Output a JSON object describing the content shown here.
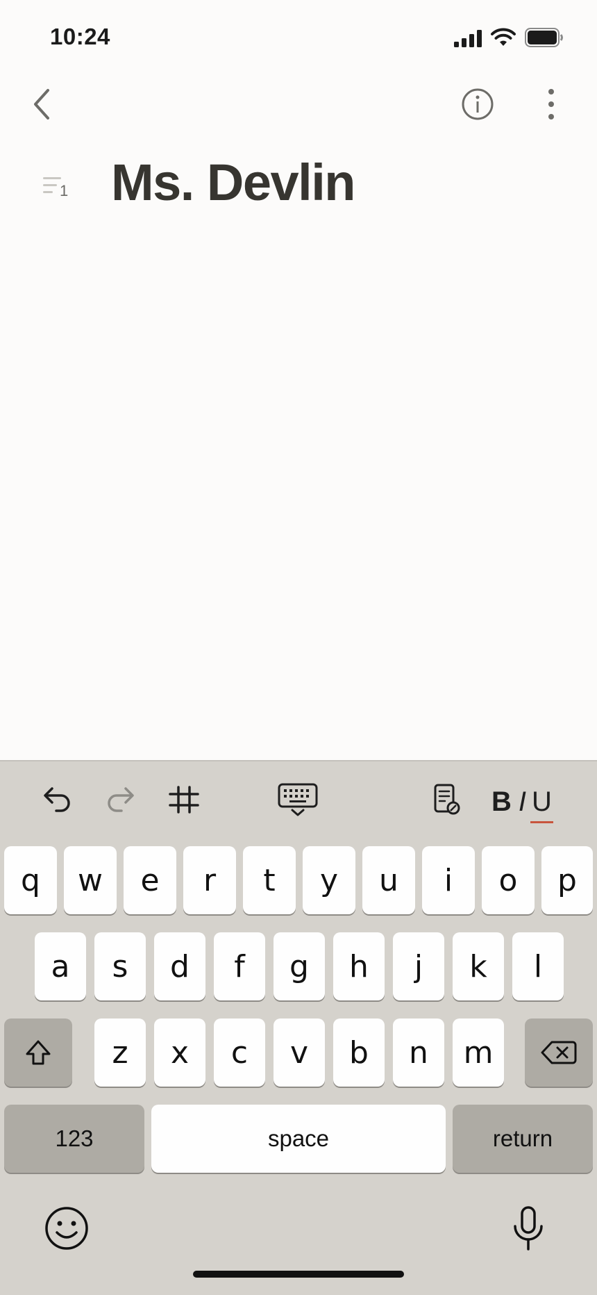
{
  "status_bar": {
    "time": "10:24"
  },
  "page": {
    "title": "Ms. Devlin",
    "toc_count": "1"
  },
  "toolbar": {
    "bold_label": "B",
    "italic_label": "I",
    "underline_label": "U"
  },
  "keyboard": {
    "row1": [
      "q",
      "w",
      "e",
      "r",
      "t",
      "y",
      "u",
      "i",
      "o",
      "p"
    ],
    "row2": [
      "a",
      "s",
      "d",
      "f",
      "g",
      "h",
      "j",
      "k",
      "l"
    ],
    "row3": [
      "z",
      "x",
      "c",
      "v",
      "b",
      "n",
      "m"
    ],
    "numbers_label": "123",
    "space_label": "space",
    "return_label": "return"
  },
  "colors": {
    "background": "#fcfbfa",
    "keyboard_bg": "#d5d2cc",
    "underline_accent": "#c8553d"
  }
}
